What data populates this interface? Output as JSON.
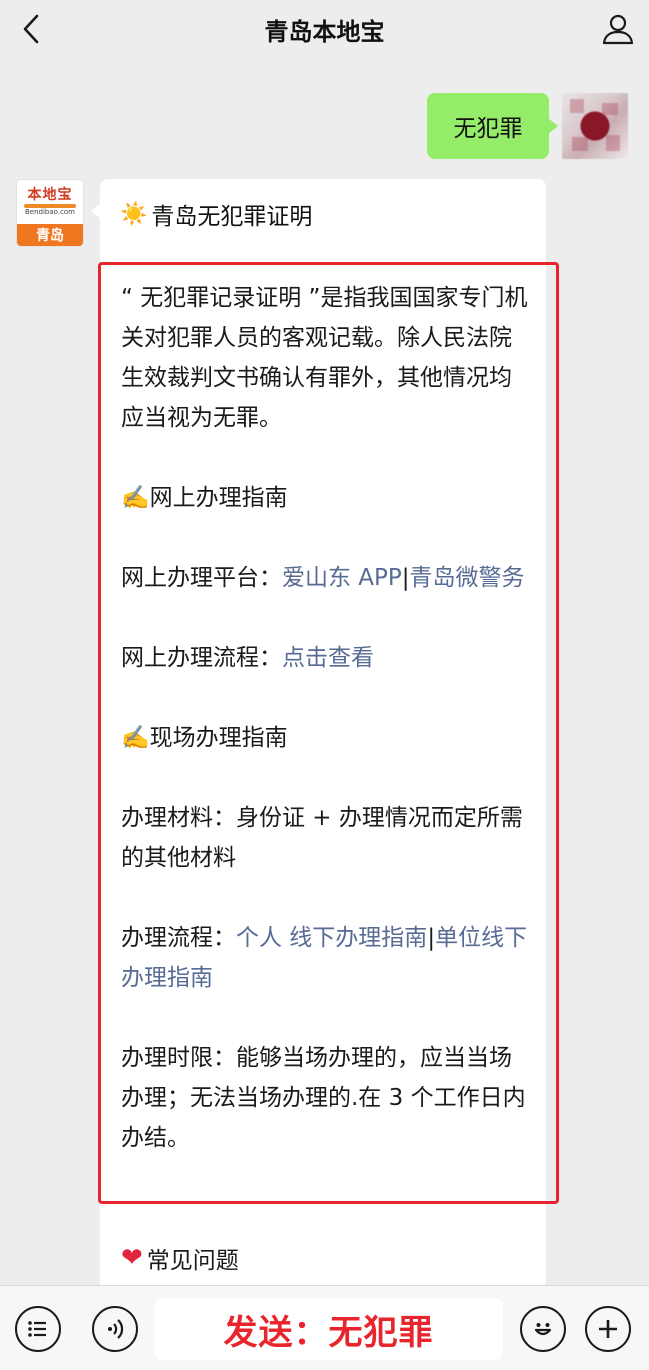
{
  "header": {
    "title": "青岛本地宝"
  },
  "outgoing_message": {
    "text": "无犯罪"
  },
  "bot": {
    "avatar_brand": "本地宝",
    "avatar_domain": "Bendibao.com",
    "avatar_city": "青岛"
  },
  "card": {
    "title": "青岛无犯罪证明",
    "intro": "“ 无犯罪记录证明 ”是指我国国家专门机关对犯罪人员的客观记载。除人民法院生效裁判文书确认有罪外，其他情况均应当视为无罪。",
    "online_heading": "网上办理指南",
    "online_platform_label": "网上办理平台：",
    "online_platform_link1": "爱山东 APP",
    "online_platform_sep": "|",
    "online_platform_link2": "青岛微警务",
    "online_process_label": "网上办理流程：",
    "online_process_link": "点击查看",
    "onsite_heading": "现场办理指南",
    "materials": "办理材料：身份证 + 办理情况而定所需的其他材料",
    "process_label": "办理流程：",
    "process_link1": "个人 线下办理指南",
    "process_sep": "|",
    "process_link2": "单位线下办理指南",
    "time_limit": "办理时限：能够当场办理的，应当当场办理；无法当场办理的.在 3 个工作日内办结。",
    "faq": "常见问题"
  },
  "input_bar": {
    "text": "发送：无犯罪"
  },
  "colors": {
    "background": "#ededed",
    "outgoing_bubble": "#95ec69",
    "link": "#576b95",
    "highlight_border": "#e8242c",
    "input_text": "#e8242c"
  }
}
